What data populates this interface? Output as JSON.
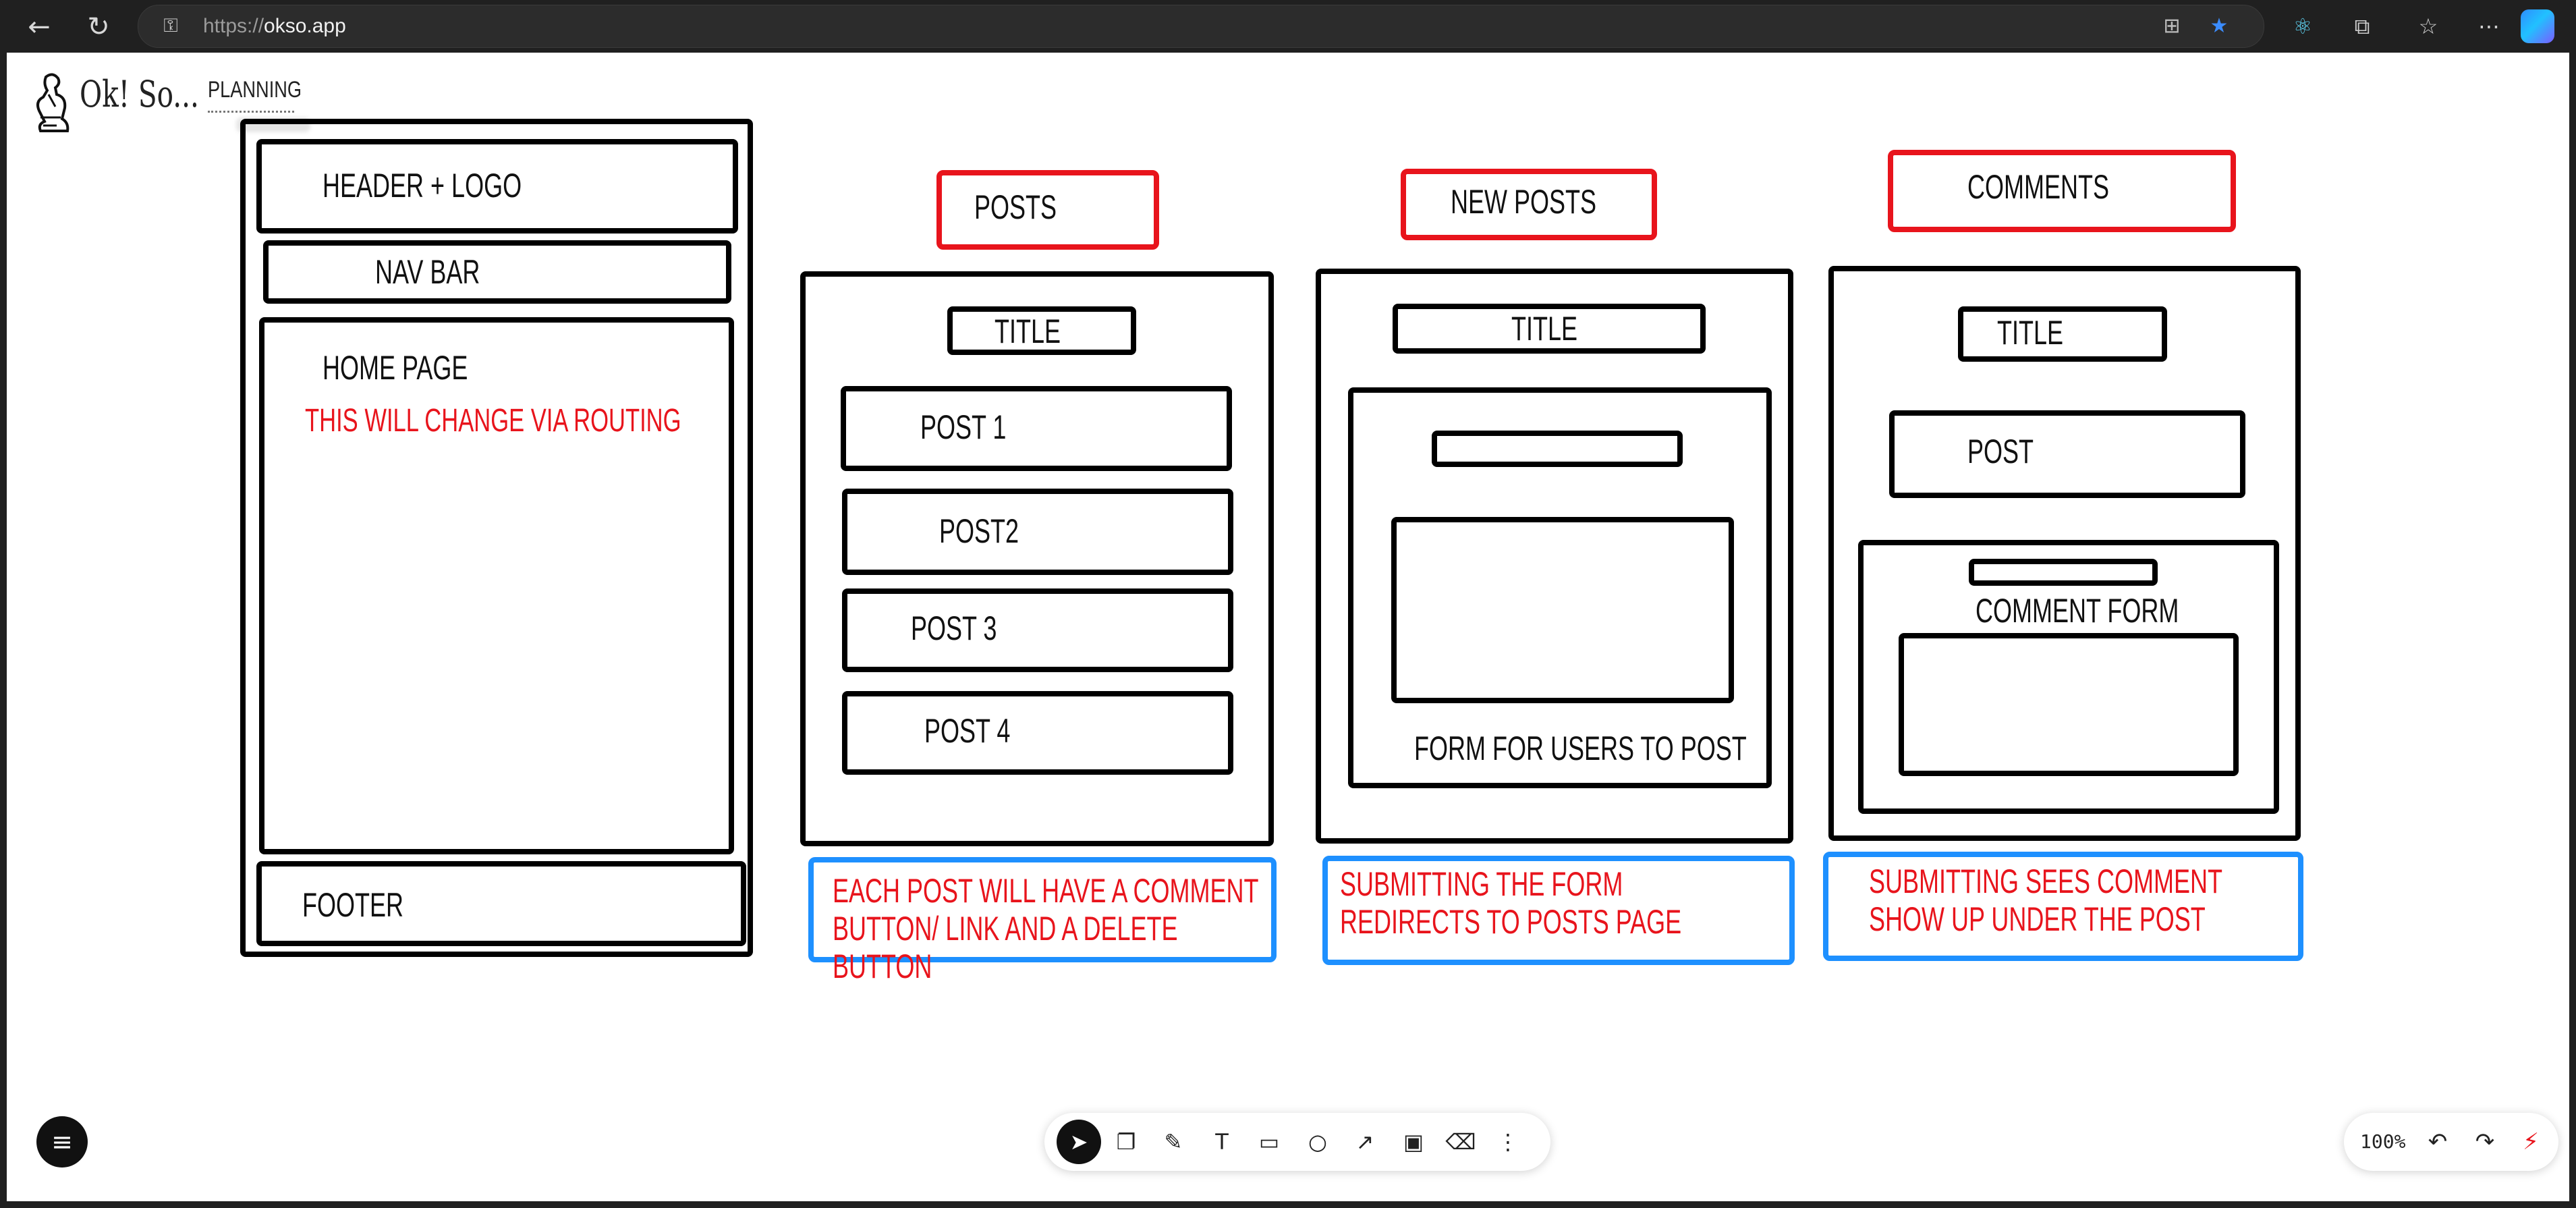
{
  "browser": {
    "url_prefix": "https://",
    "url_host": "okso.app",
    "icons": {
      "back": "arrow-left-icon",
      "refresh": "refresh-icon",
      "lock": "lock-icon",
      "split": "split-screen-icon",
      "favorite": "star-icon",
      "react_ext": "react-icon",
      "extensions": "puzzle-icon",
      "favorites": "favorites-icon",
      "more": "more-icon",
      "copilot": "copilot-icon"
    },
    "favorite_color": "#3b8cff"
  },
  "app": {
    "logo_text": "Ok! So...",
    "board_title": "PLANNING"
  },
  "wireframe": {
    "layout": {
      "header": "HEADER + LOGO",
      "nav": "NAV BAR",
      "home": "HOME PAGE",
      "home_note": "THIS WILL CHANGE VIA ROUTING",
      "footer": "FOOTER"
    },
    "posts": {
      "tag": "POSTS",
      "title": "TITLE",
      "items": [
        "POST 1",
        "POST2",
        "POST 3",
        "POST 4"
      ],
      "note": "EACH POST WILL HAVE A COMMENT BUTTON/ LINK AND A DELETE BUTTON"
    },
    "new_posts": {
      "tag": "NEW POSTS",
      "title": "TITLE",
      "form_label": "FORM FOR USERS TO POST",
      "note": "SUBMITTING THE FORM REDIRECTS TO POSTS PAGE"
    },
    "comments": {
      "tag": "COMMENTS",
      "title": "TITLE",
      "post": "POST",
      "form_label": "COMMENT FORM",
      "note": "SUBMITTING SEES COMMENT SHOW UP UNDER THE POST"
    },
    "colors": {
      "stroke": "#000000",
      "red": "#e8141c",
      "blue": "#1e90ff"
    }
  },
  "toolbar": {
    "tools": [
      "select-arrow-icon",
      "shapes-icon",
      "pencil-icon",
      "text-icon",
      "rectangle-icon",
      "circle-icon",
      "arrow-icon",
      "image-icon",
      "eraser-icon",
      "more-vertical-icon"
    ],
    "active_tool": "select-arrow-icon"
  },
  "zoom": {
    "level": "100%",
    "icons": [
      "undo-icon",
      "redo-icon",
      "status-icon"
    ]
  },
  "menu": {
    "icon": "menu-icon"
  }
}
